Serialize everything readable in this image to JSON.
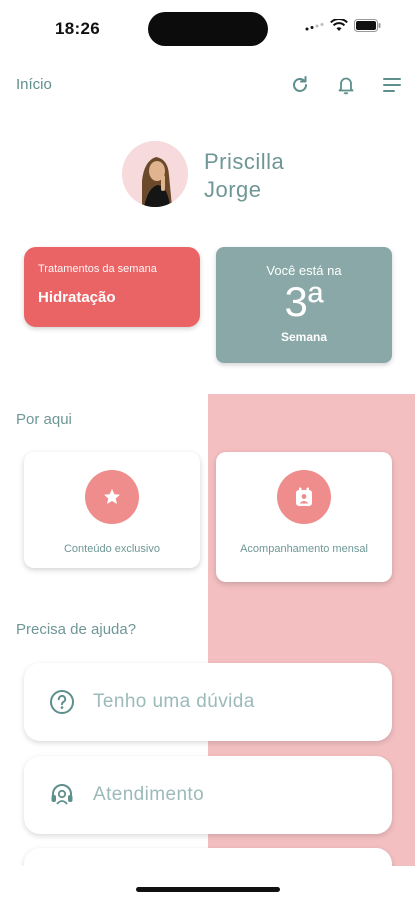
{
  "status_bar": {
    "time": "18:26"
  },
  "topnav": {
    "title": "Início",
    "icons": [
      "refresh-icon",
      "bell-icon",
      "menu-icon"
    ]
  },
  "profile": {
    "first_name": "Priscilla",
    "last_name": "Jorge"
  },
  "treatments_card": {
    "label": "Tratamentos da semana",
    "value": "Hidratação"
  },
  "week_card": {
    "line1": "Você está na",
    "number": "3ª",
    "line3": "Semana"
  },
  "sections": {
    "por_aqui": "Por aqui",
    "ajuda": "Precisa de ajuda?"
  },
  "features": [
    {
      "label": "Conteúdo exclusivo",
      "icon": "star-icon"
    },
    {
      "label": "Acompanhamento mensal",
      "icon": "calendar-person-icon"
    }
  ],
  "help": [
    {
      "label": "Tenho uma dúvida",
      "icon": "question-icon"
    },
    {
      "label": "Atendimento",
      "icon": "headset-icon"
    }
  ],
  "colors": {
    "teal": "#5e8f8c",
    "coral": "#ea6466",
    "gray_teal": "#89a8a7",
    "pink_bg": "#f3bfc1",
    "icon_circle": "#ef8c8c"
  }
}
